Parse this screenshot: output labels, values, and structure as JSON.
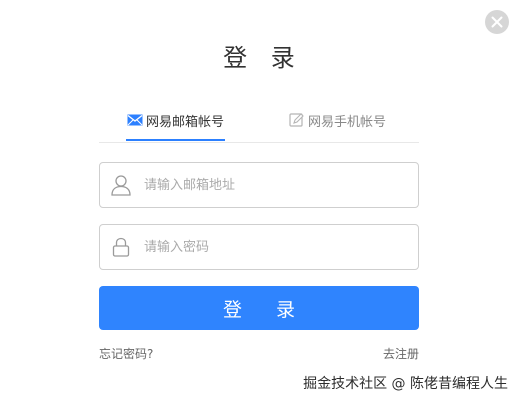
{
  "dialog": {
    "title": "登 录",
    "close_icon": "close-icon"
  },
  "tabs": [
    {
      "label": "网易邮箱帐号",
      "icon": "mail-icon",
      "active": true
    },
    {
      "label": "网易手机帐号",
      "icon": "edit-icon",
      "active": false
    }
  ],
  "fields": {
    "email": {
      "placeholder": "请输入邮箱地址",
      "value": "",
      "icon": "user-icon"
    },
    "password": {
      "placeholder": "请输入密码",
      "value": "",
      "icon": "lock-icon"
    }
  },
  "actions": {
    "login_label": "登 录",
    "forgot_label": "忘记密码?",
    "register_label": "去注册"
  },
  "watermark": "掘金技术社区 @ 陈佬昔编程人生",
  "colors": {
    "accent": "#2f84fe",
    "tab_underline": "#2c80ff",
    "close_bg": "#d6d6d6"
  }
}
